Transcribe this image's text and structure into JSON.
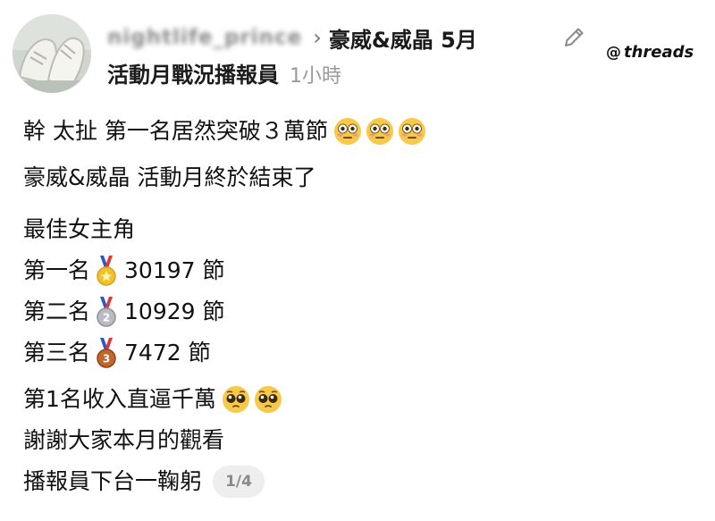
{
  "header": {
    "username": "nightlife_prince",
    "group_name": "豪威&威晶 5月",
    "subtitle": "活動月戰況播報員",
    "time_ago": "1小時"
  },
  "watermark": {
    "icon": "threads-logo",
    "label": "threads"
  },
  "post": {
    "line1": "幹 太扯 第一名居然突破３萬節",
    "line2": "豪威&威晶 活動月終於結束了",
    "heading": "最佳女主角",
    "rankings": [
      {
        "rank": "第一名",
        "medal": "gold",
        "value": "30197 節"
      },
      {
        "rank": "第二名",
        "medal": "silver",
        "value": "10929 節"
      },
      {
        "rank": "第三名",
        "medal": "bronze",
        "value": "7472 節"
      }
    ],
    "line6": "第1名收入直逼千萬",
    "line7": "謝謝大家本月的觀看",
    "line8": "播報員下台一鞠躬"
  },
  "pager": {
    "label": "1/4"
  },
  "icons": {
    "edit": "pencil-icon",
    "flushed_emoji": "flushed-face-emoji",
    "pleading_emoji": "pleading-face-emoji"
  },
  "colors": {
    "username_gray": "#8a8a8a",
    "time_gray": "#9a9a9a",
    "gold": "#f2c12e",
    "silver": "#b9bcc2",
    "bronze": "#c0672c",
    "ribbon_blue": "#2f56c6",
    "ribbon_red": "#d93a3a"
  }
}
